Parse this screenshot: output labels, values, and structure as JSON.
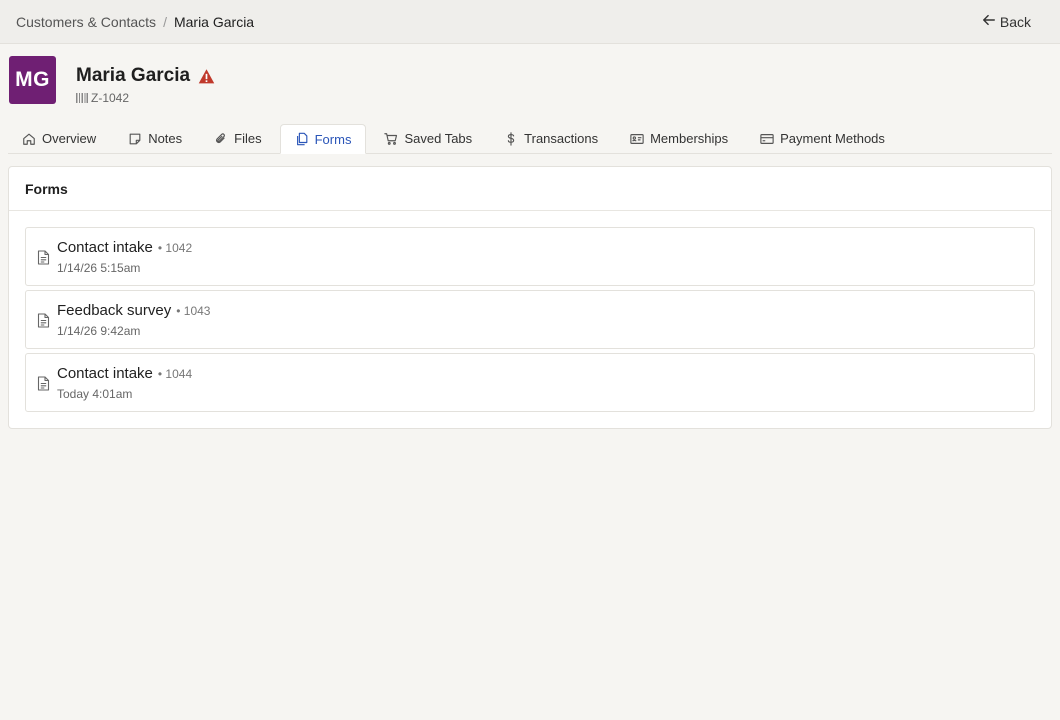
{
  "breadcrumb": {
    "parent": "Customers & Contacts",
    "separator": "/",
    "current": "Maria Garcia"
  },
  "back_label": "Back",
  "contact": {
    "initials": "MG",
    "name": "Maria Garcia",
    "id": "Z-1042",
    "avatar_color": "#6f1f73",
    "warning_color": "#c0392b"
  },
  "tabs": [
    {
      "label": "Overview",
      "icon": "home-icon",
      "active": false
    },
    {
      "label": "Notes",
      "icon": "note-icon",
      "active": false
    },
    {
      "label": "Files",
      "icon": "paperclip-icon",
      "active": false
    },
    {
      "label": "Forms",
      "icon": "forms-icon",
      "active": true
    },
    {
      "label": "Saved Tabs",
      "icon": "cart-icon",
      "active": false
    },
    {
      "label": "Transactions",
      "icon": "dollar-icon",
      "active": false
    },
    {
      "label": "Memberships",
      "icon": "id-card-icon",
      "active": false
    },
    {
      "label": "Payment Methods",
      "icon": "credit-card-icon",
      "active": false
    }
  ],
  "accent_color": "#2a55b8",
  "panel": {
    "title": "Forms",
    "items": [
      {
        "title": "Contact intake",
        "number": "• 1042",
        "date": "1/14/26 5:15am"
      },
      {
        "title": "Feedback survey",
        "number": "• 1043",
        "date": "1/14/26 9:42am"
      },
      {
        "title": "Contact intake",
        "number": "• 1044",
        "date": "Today 4:01am"
      }
    ]
  }
}
